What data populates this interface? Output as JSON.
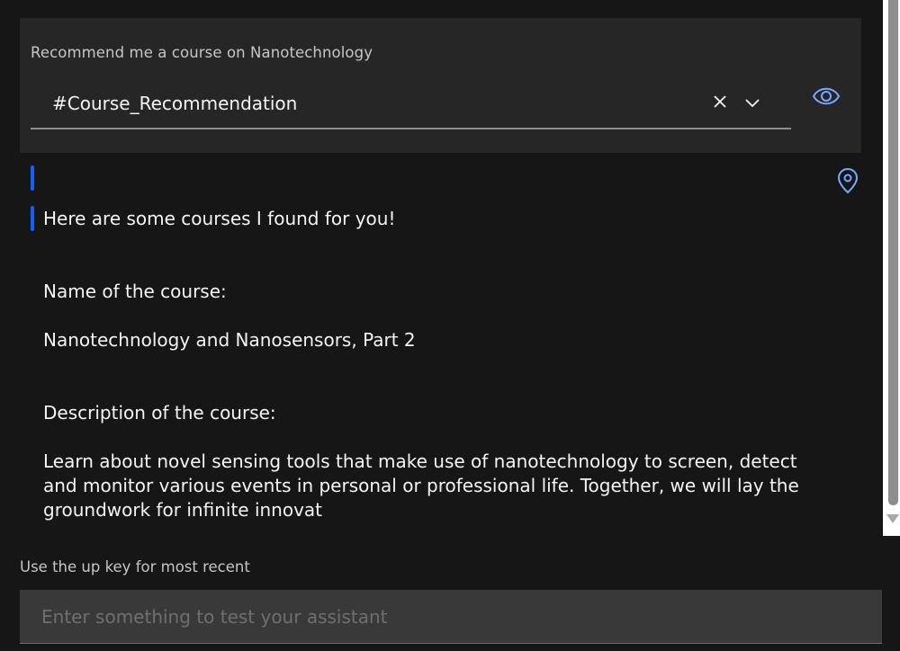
{
  "user_message": {
    "text": "Recommend me a course on Nanotechnology",
    "intent": "#Course_Recommendation"
  },
  "response": {
    "greeting": "Here are some courses I found for you!",
    "name_label": "Name of the course:",
    "course_name": "Nanotechnology and Nanosensors, Part 2",
    "description_label": "Description of the course:",
    "description": "Learn about novel sensing tools that make use of nanotechnology to screen, detect and monitor various events in personal or professional life. Together, we will lay the groundwork for infinite innovat"
  },
  "footer": {
    "hint": "Use the up key for most recent",
    "input_placeholder": "Enter something to test your assistant",
    "input_value": ""
  },
  "colors": {
    "background": "#161616",
    "card": "#262626",
    "accent": "#0f62fe",
    "icon": "#78a9ff"
  },
  "icons": [
    "close-icon",
    "chevron-down-icon",
    "eye-icon",
    "location-pin-icon"
  ]
}
